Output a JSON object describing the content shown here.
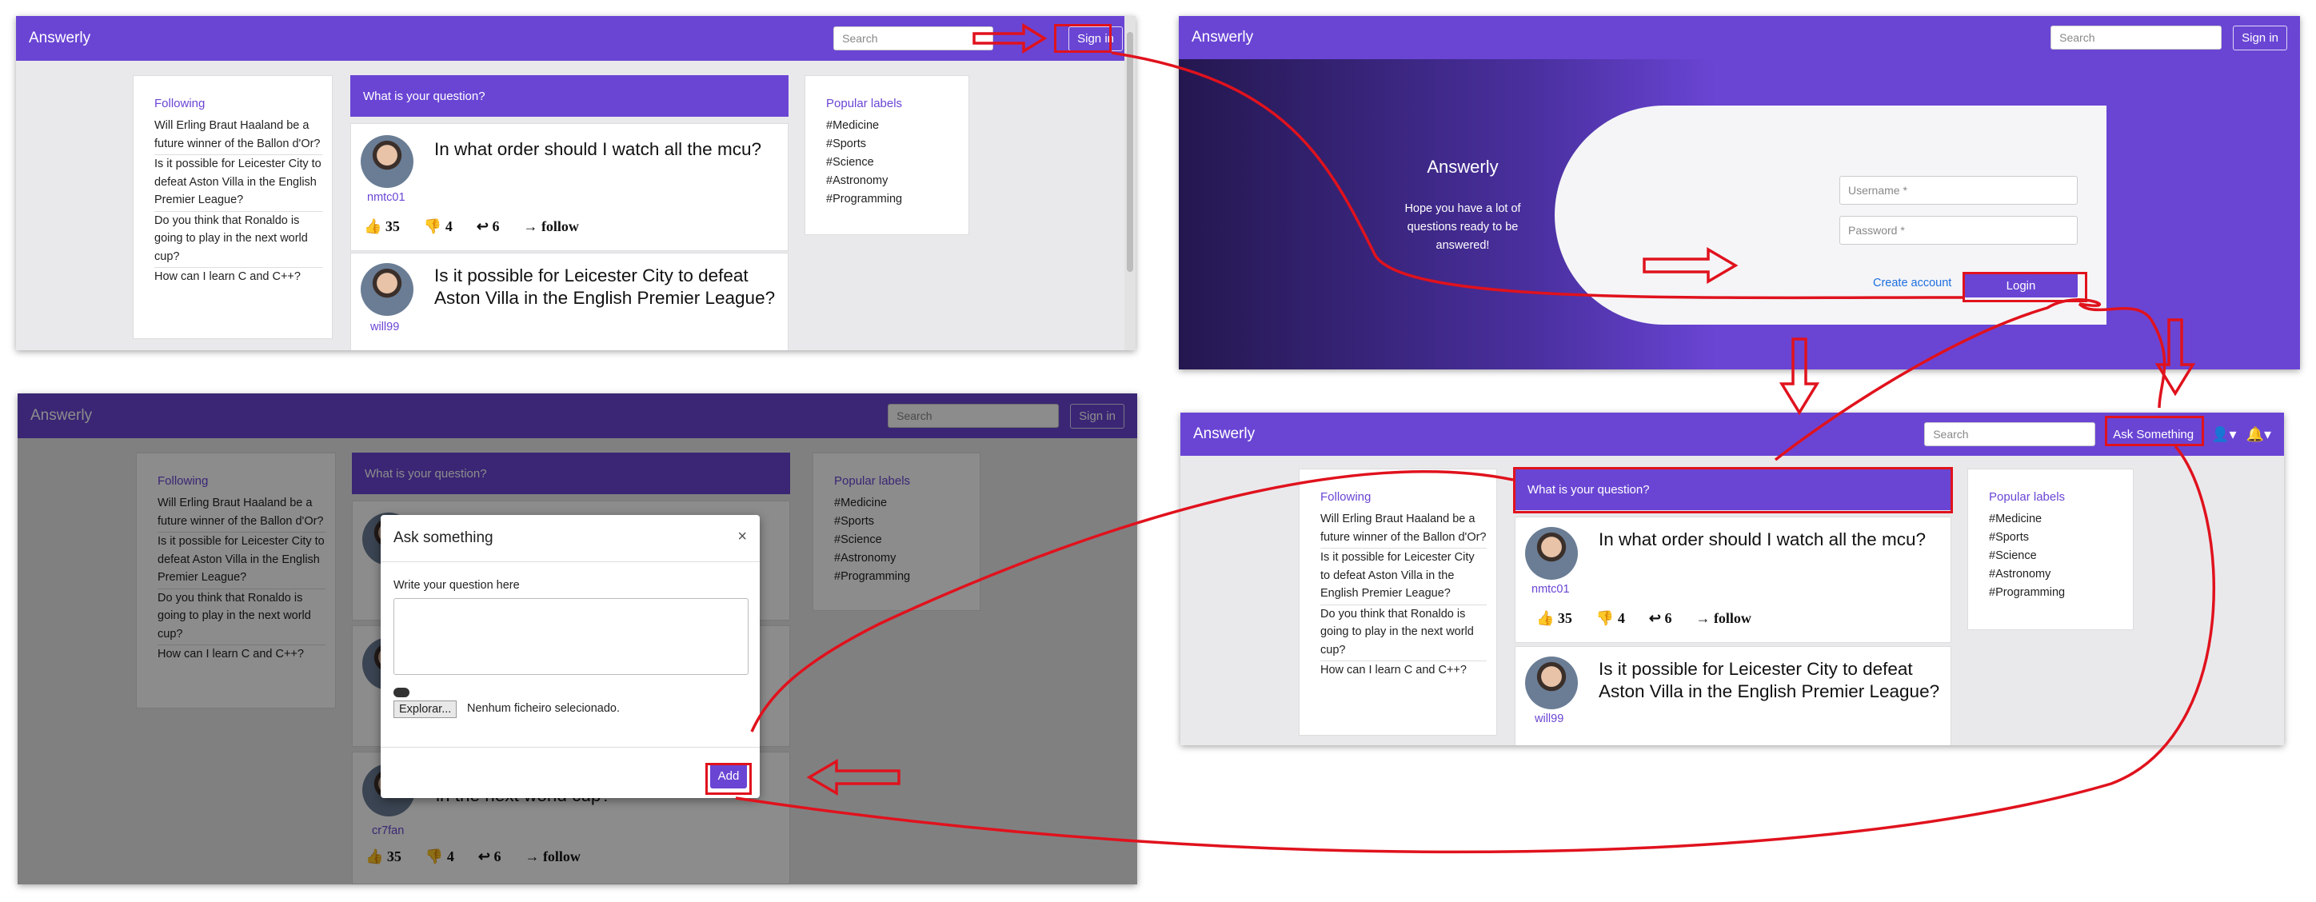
{
  "app": {
    "brand": "Answerly",
    "search_placeholder": "Search",
    "sign_in": "Sign in",
    "ask_something": "Ask Something"
  },
  "sidebar": {
    "following_title": "Following",
    "following": [
      "Will Erling Braut Haaland be a future winner of the Ballon d'Or?",
      "Is it possible for Leicester City to defeat Aston Villa in the English Premier League?",
      "Do you think that Ronaldo is going to play in the next world cup?",
      "How can I learn C and C++?"
    ],
    "labels_title": "Popular labels",
    "labels": [
      "#Medicine",
      "#Sports",
      "#Science",
      "#Astronomy",
      "#Programming"
    ]
  },
  "feed": {
    "ask_bar": "What is your question?",
    "questions": [
      {
        "title": "In what order should I watch all the mcu?",
        "user": "nmtc01",
        "likes": "35",
        "dislikes": "4",
        "answers": "6",
        "follow": "follow"
      },
      {
        "title": "Is it possible for Leicester City to defeat Aston Villa in the English Premier League?",
        "user": "will99"
      },
      {
        "title": "Do you think that Ronaldo is going to play in the next world cup?",
        "title_visible": "in the next world cup?",
        "user": "cr7fan",
        "likes": "35",
        "dislikes": "4",
        "answers": "6",
        "follow": "follow"
      }
    ]
  },
  "login": {
    "title": "Answerly",
    "subtitle": "Hope you have a lot of questions ready to be answered!",
    "username_placeholder": "Username *",
    "password_placeholder": "Password *",
    "create_account": "Create account",
    "login_button": "Login"
  },
  "modal": {
    "title": "Ask something",
    "close": "×",
    "question_label": "Write your question here",
    "browse_button": "Explorar...",
    "no_file": "Nenhum ficheiro selecionado.",
    "add_button": "Add"
  },
  "colors": {
    "primary": "#6a45d4",
    "annotation_red": "#e0121d",
    "login_dark": "#2a1d56"
  }
}
